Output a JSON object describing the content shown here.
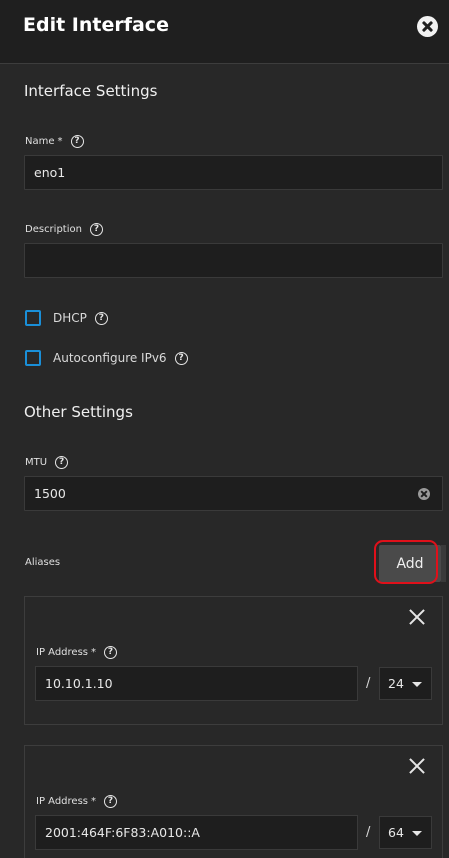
{
  "dialog": {
    "title": "Edit Interface",
    "close_icon": "close-circle-icon"
  },
  "interface_settings": {
    "heading": "Interface Settings",
    "name_label": "Name",
    "name_required": "*",
    "name_value": "eno1",
    "description_label": "Description",
    "description_value": "",
    "dhcp_label": "DHCP",
    "dhcp_checked": false,
    "ipv6_label": "Autoconfigure IPv6",
    "ipv6_checked": false
  },
  "other_settings": {
    "heading": "Other Settings",
    "mtu_label": "MTU",
    "mtu_value": "1500"
  },
  "aliases": {
    "label": "Aliases",
    "add_label": "Add",
    "items": [
      {
        "ip_label": "IP Address",
        "required": "*",
        "ip_value": "10.10.1.10",
        "slash": "/",
        "netmask": "24"
      },
      {
        "ip_label": "IP Address",
        "required": "*",
        "ip_value": "2001:464F:6F83:A010::A",
        "slash": "/",
        "netmask": "64"
      }
    ]
  },
  "help_glyph": "?",
  "colors": {
    "background": "#282828",
    "header": "#1f1f1f",
    "input_bg": "#1e1e1e",
    "checkbox_accent": "#1a8fd8",
    "highlight": "#e0101a"
  }
}
